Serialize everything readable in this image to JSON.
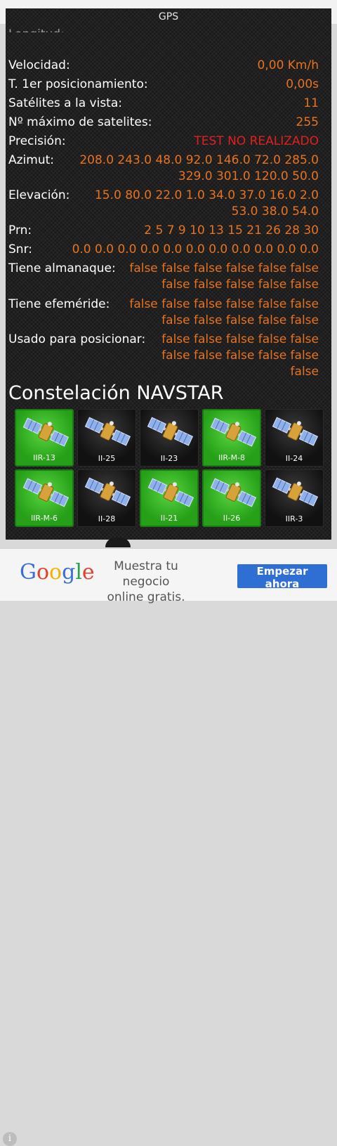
{
  "app": {
    "title": "GPS",
    "cut_label": "Longitud:"
  },
  "rows": [
    {
      "label": "Velocidad:",
      "value": "0,00 Km/h"
    },
    {
      "label": "T. 1er posicionamiento:",
      "value": "0,00s"
    },
    {
      "label": "Satélites a la vista:",
      "value": "11"
    },
    {
      "label": "Nº máximo de satelites:",
      "value": "255"
    },
    {
      "label": "Precisión:",
      "value": "TEST NO REALIZADO"
    },
    {
      "label": "Azimut:",
      "value": "208.0 243.0 48.0 92.0 146.0 72.0 285.0 329.0 301.0 120.0 50.0"
    },
    {
      "label": "Elevación:",
      "value": "15.0 80.0 22.0 1.0 34.0 37.0 16.0 2.0 53.0 38.0 54.0"
    },
    {
      "label": "Prn:",
      "value": "2 5 7 9 10 13 15 21 26 28 30"
    },
    {
      "label": "Snr:",
      "value": "0.0 0.0 0.0 0.0 0.0 0.0 0.0 0.0 0.0 0.0 0.0"
    },
    {
      "label": "Tiene almanaque:",
      "value": "false false false false false false false false false false false"
    },
    {
      "label": "Tiene efeméride:",
      "value": "false false false false false false false false false false false"
    },
    {
      "label": "Usado para posicionar:",
      "value": "false false false false false false false false false false false"
    }
  ],
  "colors": {
    "value": "#e8731f",
    "alert": "#e02020",
    "tile_active": "#3cc02c"
  },
  "constellation": {
    "title": "Constelación NAVSTAR",
    "satellites": [
      {
        "label": "IIR-13",
        "active": true
      },
      {
        "label": "II-25",
        "active": false
      },
      {
        "label": "II-23",
        "active": false
      },
      {
        "label": "IIR-M-8",
        "active": true
      },
      {
        "label": "II-24",
        "active": false
      },
      {
        "label": "IIR-M-6",
        "active": true
      },
      {
        "label": "II-28",
        "active": false
      },
      {
        "label": "II-21",
        "active": true
      },
      {
        "label": "II-26",
        "active": true
      },
      {
        "label": "IIR-3",
        "active": false
      }
    ]
  },
  "ad": {
    "logo": "Google",
    "line1": "Muestra tu negocio",
    "line2": "online gratis.",
    "button": "Empezar ahora",
    "info": "i"
  }
}
